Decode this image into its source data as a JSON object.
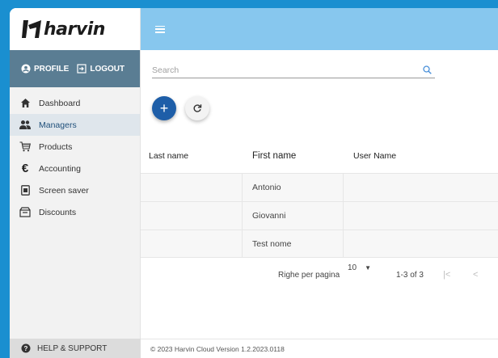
{
  "brand": {
    "name": "harvin"
  },
  "profile_bar": {
    "profile_label": "PROFILE",
    "logout_label": "LOGOUT"
  },
  "sidebar": {
    "items": [
      {
        "label": "Dashboard",
        "icon": "home-icon",
        "active": false
      },
      {
        "label": "Managers",
        "icon": "users-icon",
        "active": true
      },
      {
        "label": "Products",
        "icon": "cart-icon",
        "active": false
      },
      {
        "label": "Accounting",
        "icon": "euro-icon",
        "active": false
      },
      {
        "label": "Screen saver",
        "icon": "screen-icon",
        "active": false
      },
      {
        "label": "Discounts",
        "icon": "store-icon",
        "active": false
      }
    ],
    "help_label": "HELP & SUPPORT"
  },
  "search": {
    "placeholder": "Search",
    "value": ""
  },
  "table": {
    "columns": [
      "Last name",
      "First name",
      "User Name"
    ],
    "rows": [
      {
        "last_name": "",
        "first_name": "Antonio",
        "user_name": ""
      },
      {
        "last_name": "",
        "first_name": "Giovanni",
        "user_name": ""
      },
      {
        "last_name": "",
        "first_name": "Test nome",
        "user_name": ""
      }
    ]
  },
  "pagination": {
    "rows_per_page_label": "Righe per pagina",
    "rows_per_page_value": "10",
    "range": "1-3 of 3"
  },
  "footer": {
    "text": "© 2023 Harvin Cloud Version 1.2.2023.0118"
  },
  "colors": {
    "topbar": "#87c7ee",
    "profile_bar": "#5a7d93",
    "fab_primary": "#1e5ea8",
    "background": "#1a8fd0"
  }
}
